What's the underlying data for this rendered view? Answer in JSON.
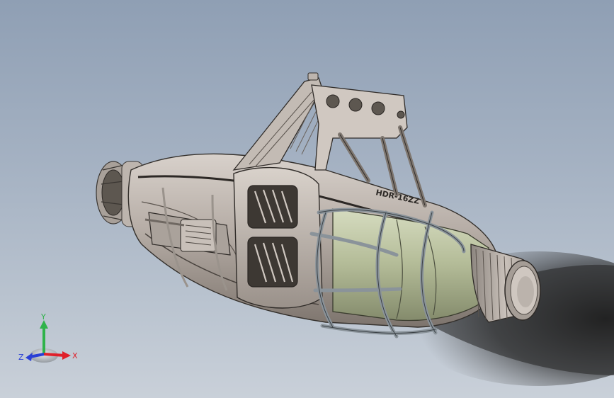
{
  "model": {
    "engraving": "HDR-16ZZ"
  },
  "triad": {
    "x_label": "X",
    "y_label": "Y",
    "z_label": "Z",
    "x_color": "#e0202a",
    "y_color": "#2fb34a",
    "z_color": "#2a3fd6"
  },
  "colors": {
    "background_top": "#8f9fb4",
    "background_bottom": "#c9d0d9",
    "body": "#b9b0a8",
    "body_dark": "#6e6660",
    "nozzle_green": "#b8bf9c",
    "cage": "#8c959c"
  }
}
